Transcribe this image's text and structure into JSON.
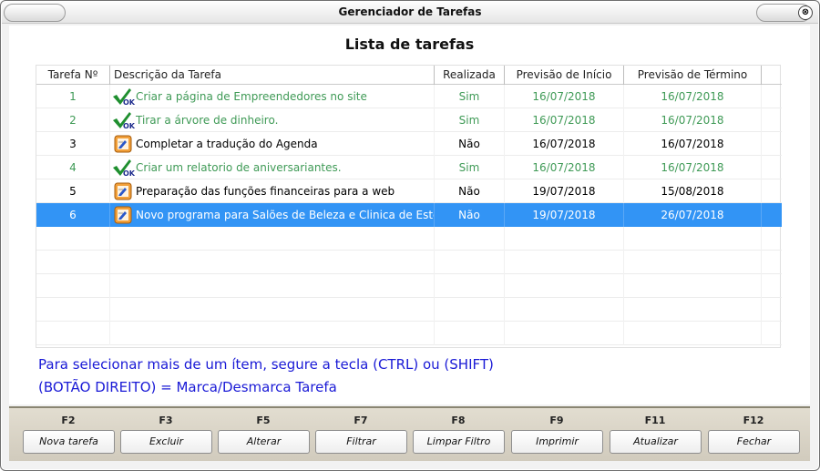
{
  "window": {
    "title": "Gerenciador de Tarefas",
    "close_glyph": "⊗"
  },
  "list_title": "Lista de tarefas",
  "columns": [
    "Tarefa Nº",
    "Descrição da Tarefa",
    "Realizada",
    "Previsão de Início",
    "Previsão de Término"
  ],
  "rows": [
    {
      "num": "1",
      "icon": "ok-check-icon",
      "desc": "Criar a página de Empreendedores no site",
      "done": "Sim",
      "start": "16/07/2018",
      "end": "16/07/2018",
      "state": "done"
    },
    {
      "num": "2",
      "icon": "ok-check-icon",
      "desc": "Tirar a árvore de dinheiro.",
      "done": "Sim",
      "start": "16/07/2018",
      "end": "16/07/2018",
      "state": "done"
    },
    {
      "num": "3",
      "icon": "edit-note-icon",
      "desc": "Completar a tradução do Agenda",
      "done": "Não",
      "start": "16/07/2018",
      "end": "16/07/2018",
      "state": "pending"
    },
    {
      "num": "4",
      "icon": "ok-check-icon",
      "desc": "Criar um relatorio de aniversariantes.",
      "done": "Sim",
      "start": "16/07/2018",
      "end": "16/07/2018",
      "state": "done"
    },
    {
      "num": "5",
      "icon": "edit-note-icon",
      "desc": "Preparação das funções financeiras para a web",
      "done": "Não",
      "start": "19/07/2018",
      "end": "15/08/2018",
      "state": "pending"
    },
    {
      "num": "6",
      "icon": "edit-note-icon",
      "desc": "Novo programa para Salões de Beleza e Clinica de Estética",
      "done": "Não",
      "start": "19/07/2018",
      "end": "26/07/2018",
      "state": "selected"
    }
  ],
  "hints": [
    "Para selecionar mais de um ítem, segure a tecla (CTRL) ou (SHIFT)",
    "(BOTÃO DIREITO) = Marca/Desmarca Tarefa"
  ],
  "function_keys": [
    {
      "key": "F2",
      "label": "Nova tarefa"
    },
    {
      "key": "F3",
      "label": "Excluir"
    },
    {
      "key": "F5",
      "label": "Alterar"
    },
    {
      "key": "F7",
      "label": "Filtrar"
    },
    {
      "key": "F8",
      "label": "Limpar Filtro"
    },
    {
      "key": "F9",
      "label": "Imprimir"
    },
    {
      "key": "F11",
      "label": "Atualizar"
    },
    {
      "key": "F12",
      "label": "Fechar"
    }
  ],
  "colors": {
    "done_text": "#3f9a56",
    "selected_bg": "#3294f5",
    "hint_text": "#1a1ad6"
  }
}
